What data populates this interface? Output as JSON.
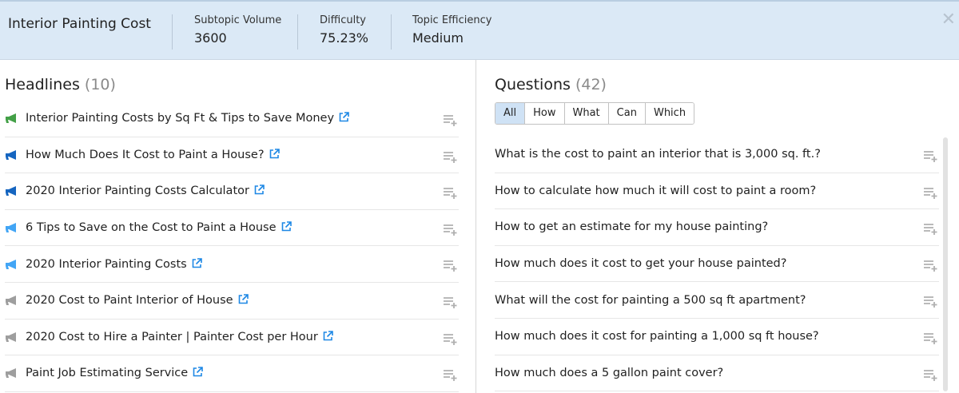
{
  "header": {
    "title": "Interior Painting Cost",
    "metrics": [
      {
        "label": "Subtopic Volume",
        "value": "3600"
      },
      {
        "label": "Difficulty",
        "value": "75.23%"
      },
      {
        "label": "Topic Efficiency",
        "value": "Medium"
      }
    ]
  },
  "headlines": {
    "title": "Headlines",
    "count": "(10)",
    "items": [
      {
        "text": "Interior Painting Costs by Sq Ft & Tips to Save Money",
        "color": "#43a047"
      },
      {
        "text": "How Much Does It Cost to Paint a House?",
        "color": "#1565c0"
      },
      {
        "text": "2020 Interior Painting Costs Calculator",
        "color": "#1565c0"
      },
      {
        "text": "6 Tips to Save on the Cost to Paint a House",
        "color": "#42a5f5"
      },
      {
        "text": "2020 Interior Painting Costs",
        "color": "#42a5f5"
      },
      {
        "text": "2020 Cost to Paint Interior of House",
        "color": "#9e9e9e"
      },
      {
        "text": "2020 Cost to Hire a Painter | Painter Cost per Hour",
        "color": "#9e9e9e"
      },
      {
        "text": "Paint Job Estimating Service",
        "color": "#9e9e9e"
      }
    ]
  },
  "questions": {
    "title": "Questions",
    "count": "(42)",
    "filters": [
      "All",
      "How",
      "What",
      "Can",
      "Which"
    ],
    "active_filter": "All",
    "items": [
      "What is the cost to paint an interior that is 3,000 sq. ft.?",
      "How to calculate how much it will cost to paint a room?",
      "How to get an estimate for my house painting?",
      "How much does it cost to get your house painted?",
      "What will the cost for painting a 500 sq ft apartment?",
      "How much does it cost for painting a 1,000 sq ft house?",
      "How much does a 5 gallon paint cover?"
    ]
  },
  "colors": {
    "header_bg": "#dbe9f6",
    "link_icon": "#1e88e5",
    "active_tab": "#cfe2f5"
  },
  "icons": {
    "headline_type": "megaphone-icon",
    "external_link": "external-link-icon",
    "add_to_list": "add-to-list-icon",
    "close": "close-icon"
  }
}
